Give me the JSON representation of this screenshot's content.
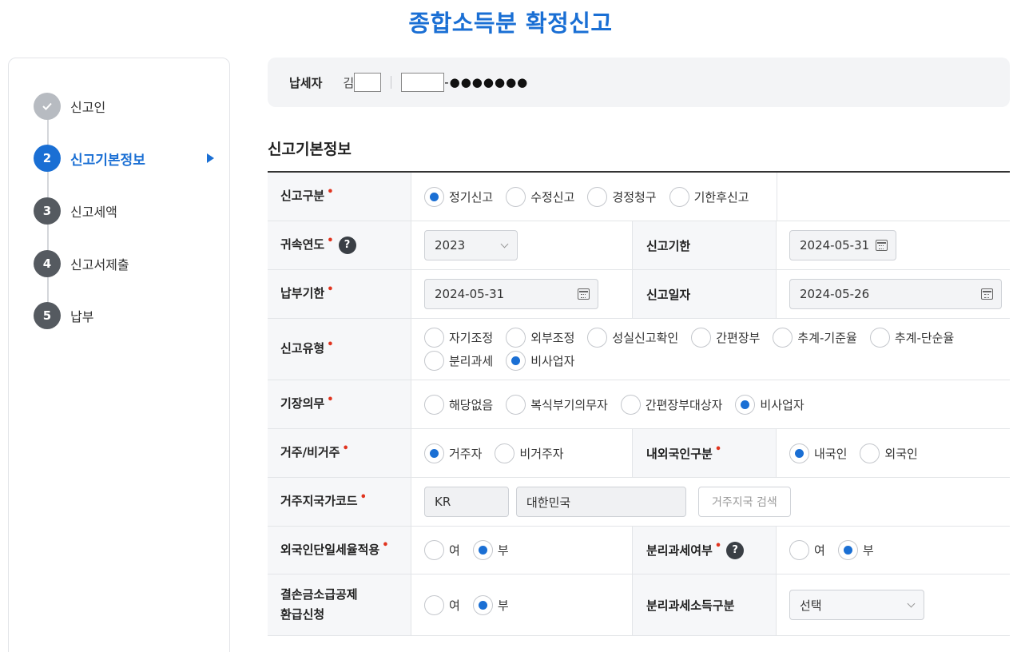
{
  "page_title": "종합소득분 확정신고",
  "sidebar": {
    "steps": [
      {
        "num": "",
        "label": "신고인"
      },
      {
        "num": "2",
        "label": "신고기본정보"
      },
      {
        "num": "3",
        "label": "신고세액"
      },
      {
        "num": "4",
        "label": "신고서제출"
      },
      {
        "num": "5",
        "label": "납부"
      }
    ]
  },
  "taxpayer": {
    "label": "납세자",
    "name_prefix": "김",
    "id_suffix": "-●●●●●●●"
  },
  "section_title": "신고기본정보",
  "form": {
    "report_type": {
      "label": "신고구분",
      "options": [
        "정기신고",
        "수정신고",
        "경정청구",
        "기한후신고"
      ],
      "selected": "정기신고"
    },
    "tax_year": {
      "label": "귀속연도",
      "value": "2023"
    },
    "report_deadline": {
      "label": "신고기한",
      "value": "2024-05-31"
    },
    "payment_deadline": {
      "label": "납부기한",
      "value": "2024-05-31"
    },
    "report_date": {
      "label": "신고일자",
      "value": "2024-05-26"
    },
    "report_kind": {
      "label": "신고유형",
      "options": [
        "자기조정",
        "외부조정",
        "성실신고확인",
        "간편장부",
        "추계-기준율",
        "추계-단순율",
        "분리과세",
        "비사업자"
      ],
      "selected": "비사업자"
    },
    "bookkeeping": {
      "label": "기장의무",
      "options": [
        "해당없음",
        "복식부기의무자",
        "간편장부대상자",
        "비사업자"
      ],
      "selected": "비사업자"
    },
    "residency": {
      "label": "거주/비거주",
      "options": [
        "거주자",
        "비거주자"
      ],
      "selected": "거주자"
    },
    "nationality": {
      "label": "내외국인구분",
      "options": [
        "내국인",
        "외국인"
      ],
      "selected": "내국인"
    },
    "country_code": {
      "label": "거주지국가코드",
      "code": "KR",
      "name": "대한민국",
      "search_button": "거주지국 검색"
    },
    "flat_rate": {
      "label": "외국인단일세율적용",
      "options": [
        "여",
        "부"
      ],
      "selected": "부"
    },
    "separate_tax": {
      "label": "분리과세여부",
      "options": [
        "여",
        "부"
      ],
      "selected": "부"
    },
    "loss_refund": {
      "label_line1": "결손금소급공제",
      "label_line2": "환급신청",
      "options": [
        "여",
        "부"
      ],
      "selected": "부"
    },
    "separate_income_type": {
      "label": "분리과세소득구분",
      "value": "선택"
    }
  },
  "required_mark": "•",
  "help_mark": "?"
}
